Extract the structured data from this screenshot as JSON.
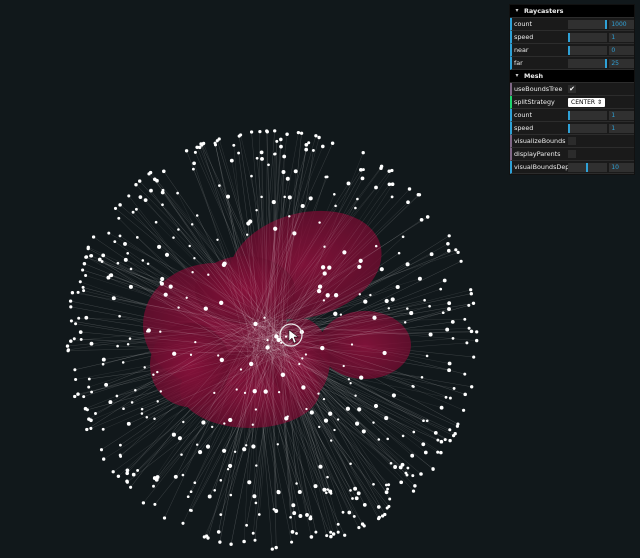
{
  "gui": {
    "raycasters": {
      "title": "Raycasters",
      "controls": [
        {
          "label": "count",
          "value": "1000",
          "fraction": 1.0
        },
        {
          "label": "speed",
          "value": "1",
          "fraction": 0.05
        },
        {
          "label": "near",
          "value": "0",
          "fraction": 0.0
        },
        {
          "label": "far",
          "value": "25",
          "fraction": 1.0
        }
      ]
    },
    "mesh": {
      "title": "Mesh",
      "useBoundsTree": {
        "label": "useBoundsTree",
        "checked": true,
        "mark": "✔"
      },
      "splitStrategy": {
        "label": "splitStrategy",
        "value": "CENTER ⇕"
      },
      "count": {
        "label": "count",
        "value": "1",
        "fraction": 0.0
      },
      "speed": {
        "label": "speed",
        "value": "1",
        "fraction": 0.05
      },
      "visualizeBounds": {
        "label": "visualizeBounds",
        "checked": false
      },
      "displayParents": {
        "label": "displayParents",
        "checked": false
      },
      "visualBoundsDepth": {
        "label": "visualBoundsDepth",
        "value": "10",
        "fraction": 0.5
      }
    }
  },
  "scene": {
    "background": "#11181b",
    "mesh_color": "#a8144a",
    "ray_color": "#ffffff",
    "raycaster_count": 1000
  }
}
